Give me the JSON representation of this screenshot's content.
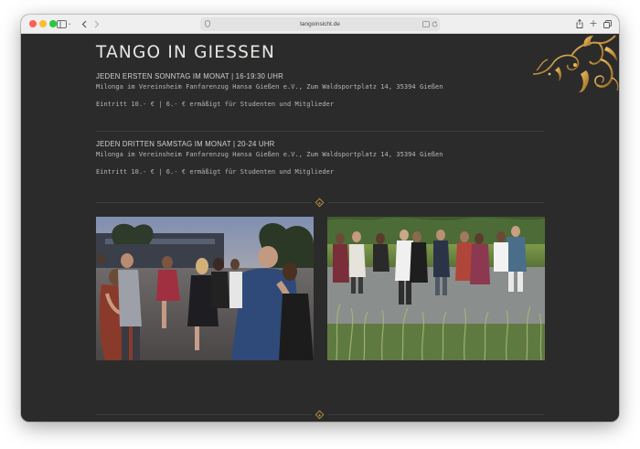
{
  "browser": {
    "url": "tangoinsicht.de",
    "icons": [
      "sidebar-icon",
      "back-icon",
      "forward-icon",
      "shield-icon",
      "translate-icon",
      "reload-icon",
      "share-icon",
      "new-tab-icon",
      "tabs-overview-icon"
    ]
  },
  "page": {
    "title": "TANGO IN GIESSEN",
    "events": [
      {
        "heading": "JEDEN ERSTEN SONNTAG IM MONAT | 16-19:30 UHR",
        "location": "Milonga im Vereinsheim Fanfarenzug Hansa Gießen e.V., Zum Waldsportplatz 14, 35394 Gießen",
        "price": "Eintritt 10.- € | 6.- € ermäßigt für Studenten und Mitglieder"
      },
      {
        "heading": "JEDEN DRITTEN SAMSTAG IM MONAT | 20-24 UHR",
        "location": "Milonga im Vereinsheim Fanfarenzug Hansa Gießen e.V., Zum Waldsportplatz 14, 35394 Gießen",
        "price": "Eintritt 10.- € | 6.- € ermäßigt für Studenten und Mitglieder"
      }
    ],
    "photos": [
      "tango-dancers-evening-photo",
      "tango-dancers-outdoor-photo"
    ]
  },
  "colors": {
    "background": "#2b2b2b",
    "text": "#e8e6e3",
    "accent_gold": "#c9963e"
  }
}
